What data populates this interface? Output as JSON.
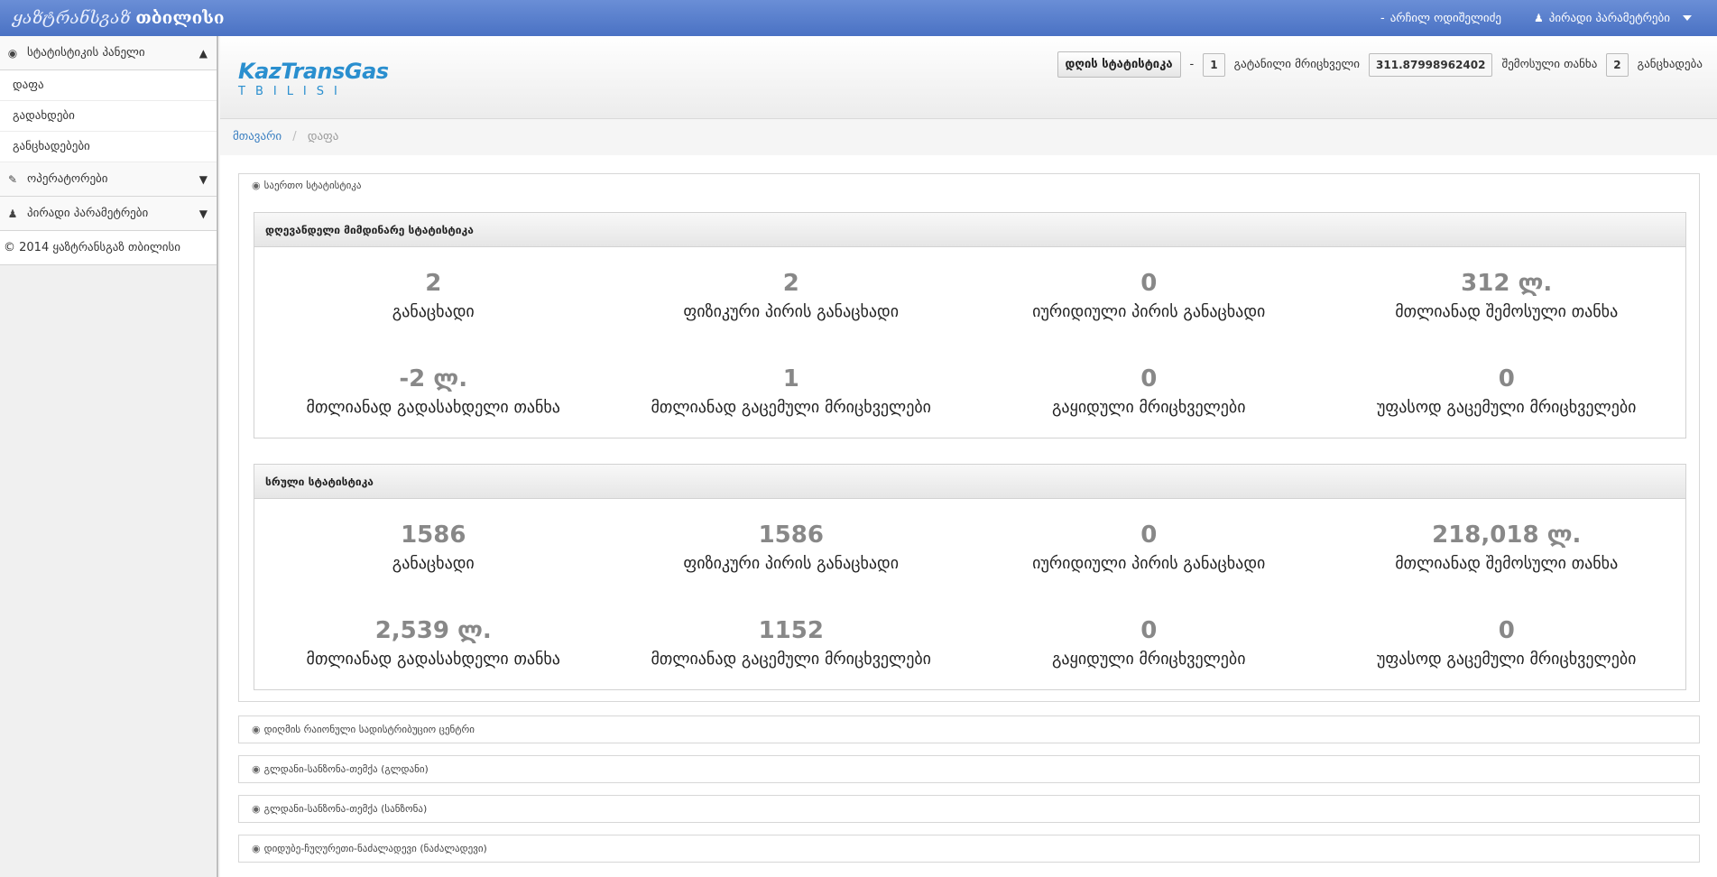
{
  "app": {
    "brand_italic": "ყაზტრანსგაზ",
    "brand_bold": "თბილისი",
    "user_prefix": "-",
    "user_name": "არჩილ ოდიშელიძე",
    "params_menu": "პირადი პარამეტრები"
  },
  "sidebar": {
    "stats_panel": "სტატისტიკის პანელი",
    "items": [
      "დაფა",
      "გადახდები",
      "განცხადებები"
    ],
    "operators": "ოპერატორები",
    "personal": "პირადი პარამეტრები",
    "footer": "© 2014 ყაზტრანსგაზ თბილისი"
  },
  "logo": {
    "line1": "KazTransGas",
    "line2": "TBILISI"
  },
  "header_stats": {
    "button": "დღის სტატისტიკა",
    "dash": "-",
    "meters_count": "1",
    "meters_label": "გატანილი მრიცხველი",
    "amount": "311.87998962402",
    "amount_label": "შემოსული თანხა",
    "apps_count": "2",
    "apps_label": "განცხადება"
  },
  "breadcrumb": {
    "home": "მთავარი",
    "sep": "/",
    "current": "დაფა"
  },
  "main": {
    "panel_title": "საერთო სტატისტიკა",
    "today": {
      "title": "დღევანდელი მიმდინარე სტატისტიკა",
      "cells": [
        {
          "num": "2",
          "label": "განაცხადი"
        },
        {
          "num": "2",
          "label": "ფიზიკური პირის განაცხადი"
        },
        {
          "num": "0",
          "label": "იურიდიული პირის განაცხადი"
        },
        {
          "num": "312 ლ.",
          "label": "მთლიანად შემოსული თანხა"
        },
        {
          "num": "-2 ლ.",
          "label": "მთლიანად გადასახდელი თანხა"
        },
        {
          "num": "1",
          "label": "მთლიანად გაცემული მრიცხველები"
        },
        {
          "num": "0",
          "label": "გაყიდული მრიცხველები"
        },
        {
          "num": "0",
          "label": "უფასოდ გაცემული მრიცხველები"
        }
      ]
    },
    "full": {
      "title": "სრული სტატისტიკა",
      "cells": [
        {
          "num": "1586",
          "label": "განაცხადი"
        },
        {
          "num": "1586",
          "label": "ფიზიკური პირის განაცხადი"
        },
        {
          "num": "0",
          "label": "იურიდიული პირის განაცხადი"
        },
        {
          "num": "218,018 ლ.",
          "label": "მთლიანად შემოსული თანხა"
        },
        {
          "num": "2,539 ლ.",
          "label": "მთლიანად გადასახდელი თანხა"
        },
        {
          "num": "1152",
          "label": "მთლიანად გაცემული მრიცხველები"
        },
        {
          "num": "0",
          "label": "გაყიდული მრიცხველები"
        },
        {
          "num": "0",
          "label": "უფასოდ გაცემული მრიცხველები"
        }
      ]
    },
    "regions": [
      "დიღმის რაიონული სადისტრიბუციო ცენტრი",
      "გლდანი-სანზონა-თემქა (გლდანი)",
      "გლდანი-სანზონა-თემქა (სანზონა)",
      "დიდუბე-ჩუღურეთი-ნაძალადევი (ნაძალადევი)"
    ]
  }
}
